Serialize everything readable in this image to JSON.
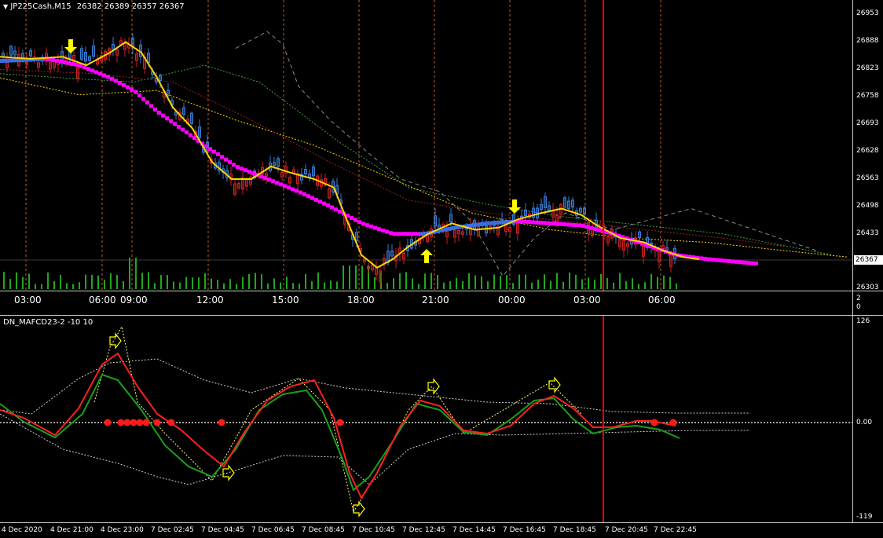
{
  "main_chart": {
    "title": "JP225Cash,M15",
    "ohlc_text": "26382 26389 26357 26367",
    "price_ticks": [
      "26953",
      "26888",
      "26823",
      "26758",
      "26693",
      "26628",
      "26563",
      "26498",
      "26433",
      "26367",
      "26303"
    ],
    "current_price": "26367",
    "time_labels": [
      "03:00",
      "06:00",
      "09:00",
      "12:00",
      "15:00",
      "18:00",
      "21:00",
      "00:00",
      "03:00",
      "06:00"
    ]
  },
  "mini_panel": {
    "ticks": [
      "2",
      "0"
    ]
  },
  "indicator": {
    "title": "DN_MAFCD23-2 -10 10",
    "ticks": [
      "126",
      "0.00",
      "-119"
    ]
  },
  "date_axis": {
    "labels": [
      "4 Dec 2020",
      "4 Dec 21:00",
      "4 Dec 23:00",
      "7 Dec 02:45",
      "7 Dec 04:45",
      "7 Dec 06:45",
      "7 Dec 08:45",
      "7 Dec 10:45",
      "7 Dec 12:45",
      "7 Dec 14:45",
      "7 Dec 16:45",
      "7 Dec 18:45",
      "7 Dec 20:45",
      "7 Dec 22:45"
    ]
  },
  "colors": {
    "background": "#000000",
    "grid_vertical": "#ff7f27",
    "cursor_line": "#ff0000",
    "bull_candle": "#3a7bd5",
    "bear_candle": "#cc2222",
    "fast_ma": "#ffd400",
    "slow_ma_bull": "#3a6ee0",
    "slow_ma_bear": "#ff00ff",
    "volume": "#1fa81f",
    "arrows": "#ffff00",
    "osc_red": "#ff2020",
    "osc_green": "#19a019"
  },
  "chart_data": [
    {
      "type": "line",
      "title": "JP225Cash,M15",
      "x": [
        "03:00",
        "06:00",
        "09:00",
        "12:00",
        "15:00",
        "18:00",
        "21:00",
        "00:00",
        "03:00",
        "06:00"
      ],
      "series": [
        {
          "values": [
            26845,
            26830,
            26880,
            26640,
            26580,
            26340,
            26420,
            26455,
            26480,
            26400
          ]
        }
      ],
      "ylim": [
        26303,
        26953
      ],
      "signals": [
        {
          "label": "down-arrow",
          "x": "06:00"
        },
        {
          "label": "up-arrow",
          "x": "21:00"
        },
        {
          "label": "down-arrow",
          "x": "00:00"
        }
      ]
    },
    {
      "type": "line",
      "title": "DN_MAFCD23-2 -10 10",
      "x": [
        "4 Dec 2020",
        "4 Dec 21:00",
        "4 Dec 23:00",
        "7 Dec 02:45",
        "7 Dec 04:45",
        "7 Dec 06:45",
        "7 Dec 08:45",
        "7 Dec 10:45",
        "7 Dec 12:45",
        "7 Dec 14:45",
        "7 Dec 16:45",
        "7 Dec 18:45",
        "7 Dec 20:45",
        "7 Dec 22:45"
      ],
      "series": [
        {
          "values": [
            15,
            -15,
            70,
            0,
            -45,
            25,
            40,
            -75,
            25,
            -15,
            25,
            0,
            0,
            -5
          ]
        },
        {
          "values": [
            15,
            -15,
            45,
            -25,
            -50,
            10,
            35,
            -60,
            20,
            -15,
            25,
            -10,
            0,
            -15
          ]
        }
      ],
      "ylim": [
        -119,
        126
      ]
    }
  ]
}
